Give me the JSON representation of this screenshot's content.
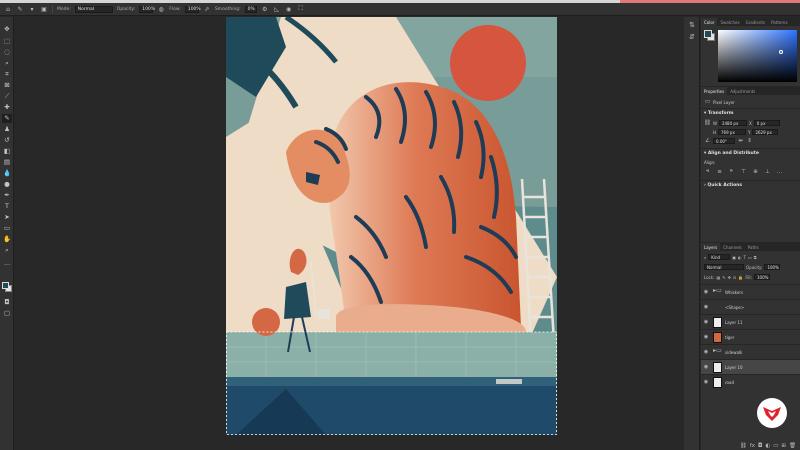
{
  "options_bar": {
    "mode_label": "Mode:",
    "mode_value": "Normal",
    "opacity_label": "Opacity:",
    "opacity_value": "100%",
    "flow_label": "Flow:",
    "flow_value": "100%",
    "smoothing_label": "Smoothing:",
    "smoothing_value": "0%"
  },
  "color_panel": {
    "tabs": [
      "Color",
      "Swatches",
      "Gradients",
      "Patterns"
    ],
    "foreground": "#1f4a5a",
    "background": "#e9e4db"
  },
  "properties_panel": {
    "tabs": [
      "Properties",
      "Adjustments"
    ],
    "layer_type": "Pixel Layer",
    "transform_header": "Transform",
    "w_value": "2480 px",
    "x_value": "0 px",
    "h_value": "769 px",
    "y_value": "2629 px",
    "angle_value": "0.00°",
    "align_header": "Align and Distribute",
    "align_label": "Align:",
    "quick_actions_header": "Quick Actions"
  },
  "layers_panel": {
    "tabs": [
      "Layers",
      "Channels",
      "Paths"
    ],
    "filter_value": "Kind",
    "blend_mode": "Normal",
    "opacity_label": "Opacity:",
    "opacity_value": "100%",
    "lock_label": "Lock:",
    "fill_label": "Fill:",
    "fill_value": "100%",
    "layers": [
      {
        "name": "Whiskers",
        "kind": "folder"
      },
      {
        "name": "<Shape>",
        "kind": "shape"
      },
      {
        "name": "Layer 11",
        "kind": "pixel"
      },
      {
        "name": "tiger",
        "kind": "tiger"
      },
      {
        "name": "sidewalk",
        "kind": "folder"
      },
      {
        "name": "Layer 10",
        "kind": "pixel",
        "selected": true
      },
      {
        "name": "road",
        "kind": "pixel"
      }
    ]
  },
  "colors": {
    "brand_logo": "#e0232a",
    "canvas_bg": "#5e8c8c",
    "tiger_orange": "#d46845",
    "sun": "#d5553f"
  }
}
